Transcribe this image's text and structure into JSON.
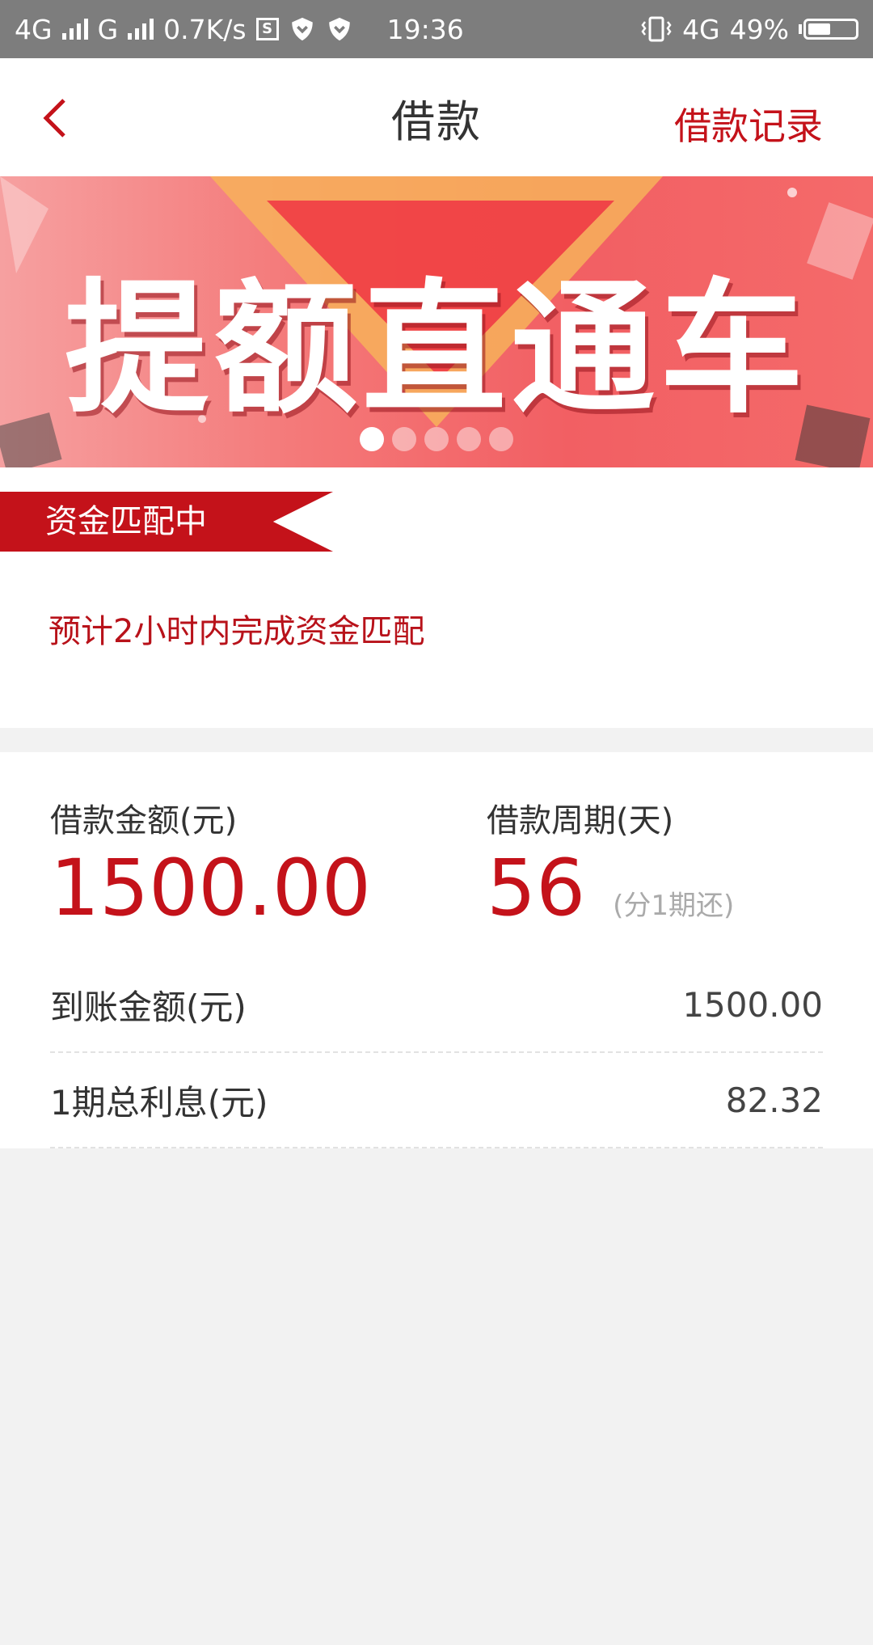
{
  "status_bar": {
    "net1": "4G",
    "net2": "G",
    "speed": "0.7K/s",
    "s_icon": "S",
    "time": "19:36",
    "net3": "4G",
    "battery": "49%",
    "battery_level": 0.49
  },
  "nav": {
    "title": "借款",
    "right_link": "借款记录",
    "accent": "#c4121a"
  },
  "banner": {
    "text": "提额直通车",
    "slide_count": 5,
    "active_slide": 1
  },
  "status": {
    "badge": "资金匹配中",
    "message": "预计2小时内完成资金匹配"
  },
  "loan": {
    "amount_label": "借款金额(元)",
    "amount": "1500.00",
    "period_label": "借款周期(天)",
    "period": "56",
    "period_note": "(分1期还)",
    "rows": [
      {
        "label": "到账金额(元)",
        "value": "1500.00"
      },
      {
        "label": "1期总利息(元)",
        "value": "82.32"
      }
    ]
  }
}
